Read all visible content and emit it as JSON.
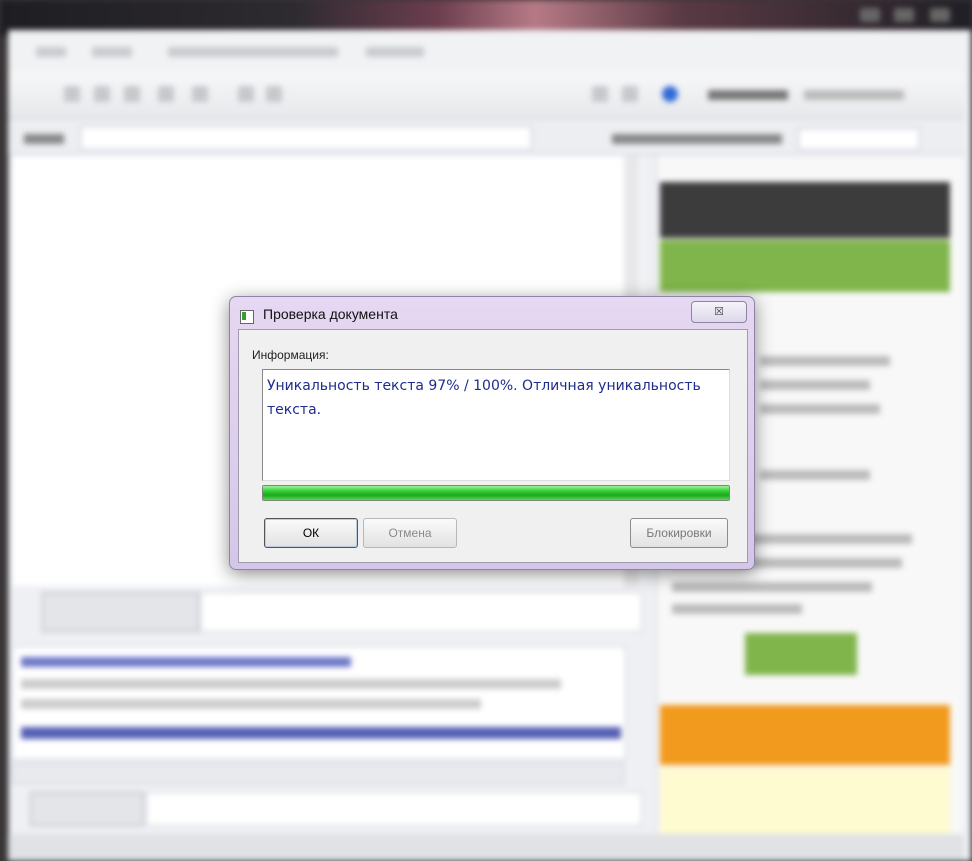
{
  "dialog": {
    "title": "Проверка документа",
    "close_glyph": "☒",
    "info_label": "Информация:",
    "info_text": "Уникальность текста 97% / 100%. Отличная уникальность текста.",
    "progress_fraction": 1.0,
    "buttons": {
      "ok": "ОК",
      "cancel": "Отмена",
      "locks": "Блокировки"
    }
  },
  "colors": {
    "info_text": "#1f2c8e",
    "progress": "#1aa81a",
    "dialog_frame": "#d4c6e8"
  }
}
